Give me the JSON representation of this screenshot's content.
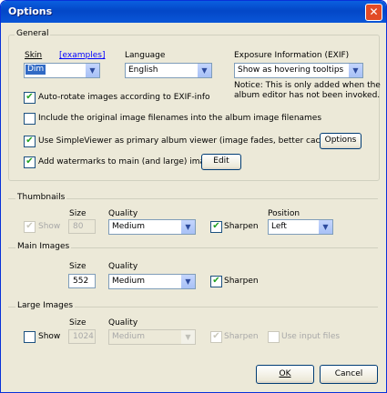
{
  "window": {
    "title": "Options"
  },
  "general": {
    "group_label": "General",
    "skin": {
      "label": "Skin",
      "link": "[examples]",
      "value": "Dim"
    },
    "language": {
      "label": "Language",
      "value": "English"
    },
    "exif": {
      "label": "Exposure Information (EXIF)",
      "value": "Show as hovering tooltips",
      "notice_line1": "Notice: This is only added when the",
      "notice_line2": "album editor has not been invoked."
    },
    "autorotate": {
      "label": "Auto-rotate images according to EXIF-info",
      "checked": true
    },
    "include_filenames": {
      "label": "Include the original image filenames into the album image filenames",
      "checked": false
    },
    "simpleviewer": {
      "label": "Use SimpleViewer as primary album viewer (image fades, better caching etc.)",
      "checked": true,
      "button": "Options"
    },
    "watermarks": {
      "label": "Add watermarks to main (and large) images",
      "checked": true,
      "button": "Edit"
    }
  },
  "thumbnails": {
    "section_label": "Thumbnails",
    "size_label": "Size",
    "quality_label": "Quality",
    "position_label": "Position",
    "show": {
      "label": "Show",
      "checked": true,
      "disabled": true
    },
    "size": "80",
    "quality": "Medium",
    "sharpen": {
      "label": "Sharpen",
      "checked": true
    },
    "position": "Left"
  },
  "main_images": {
    "section_label": "Main Images",
    "size_label": "Size",
    "quality_label": "Quality",
    "size": "552",
    "quality": "Medium",
    "sharpen": {
      "label": "Sharpen",
      "checked": true
    }
  },
  "large_images": {
    "section_label": "Large Images",
    "size_label": "Size",
    "quality_label": "Quality",
    "show": {
      "label": "Show",
      "checked": false
    },
    "size": "1024",
    "quality": "Medium",
    "sharpen": {
      "label": "Sharpen",
      "checked": true,
      "disabled": true
    },
    "use_input_files": {
      "label": "Use input files",
      "checked": false,
      "disabled": true
    }
  },
  "footer": {
    "ok": "OK",
    "cancel": "Cancel"
  }
}
